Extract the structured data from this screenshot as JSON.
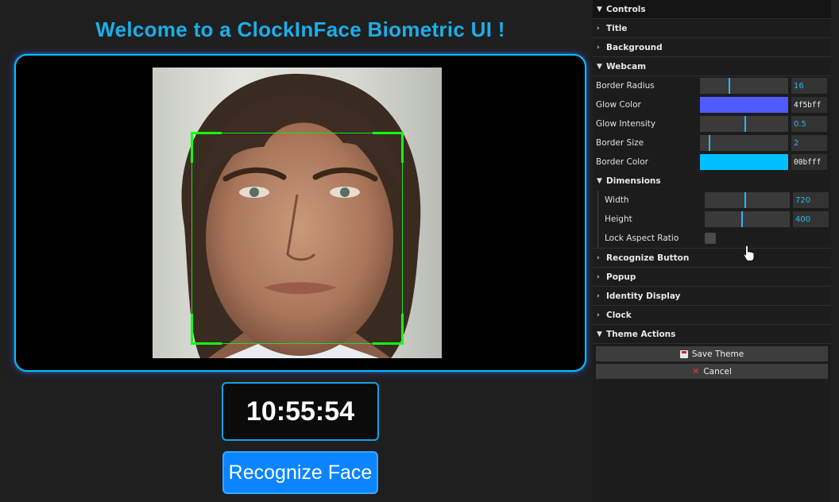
{
  "app": {
    "title": "Welcome to a ClockInFace Biometric UI !",
    "clock": "10:55:54",
    "recognize_label": "Recognize Face",
    "accent": "#00bfff",
    "button_color": "#0a84ff"
  },
  "panel": {
    "header": "Controls",
    "title_folder": "Title",
    "background_folder": "Background",
    "webcam_folder": "Webcam",
    "webcam": {
      "border_radius": {
        "label": "Border Radius",
        "value": "16",
        "fraction": 0.32
      },
      "glow_color": {
        "label": "Glow Color",
        "value": "4f5bff",
        "color": "#4f5bff"
      },
      "glow_intensity": {
        "label": "Glow Intensity",
        "value": "0.5",
        "fraction": 0.5
      },
      "border_size": {
        "label": "Border Size",
        "value": "2",
        "fraction": 0.1
      },
      "border_color": {
        "label": "Border Color",
        "value": "00bfff",
        "color": "#00bfff"
      }
    },
    "dimensions_folder": "Dimensions",
    "dimensions": {
      "width": {
        "label": "Width",
        "value": "720",
        "fraction": 0.47
      },
      "height": {
        "label": "Height",
        "value": "400",
        "fraction": 0.43
      },
      "lock_label": "Lock Aspect Ratio"
    },
    "folders_after": [
      "Recognize Button",
      "Popup",
      "Identity Display",
      "Clock"
    ],
    "theme_actions_folder": "Theme Actions",
    "save_theme": "Save Theme",
    "cancel": "Cancel"
  }
}
